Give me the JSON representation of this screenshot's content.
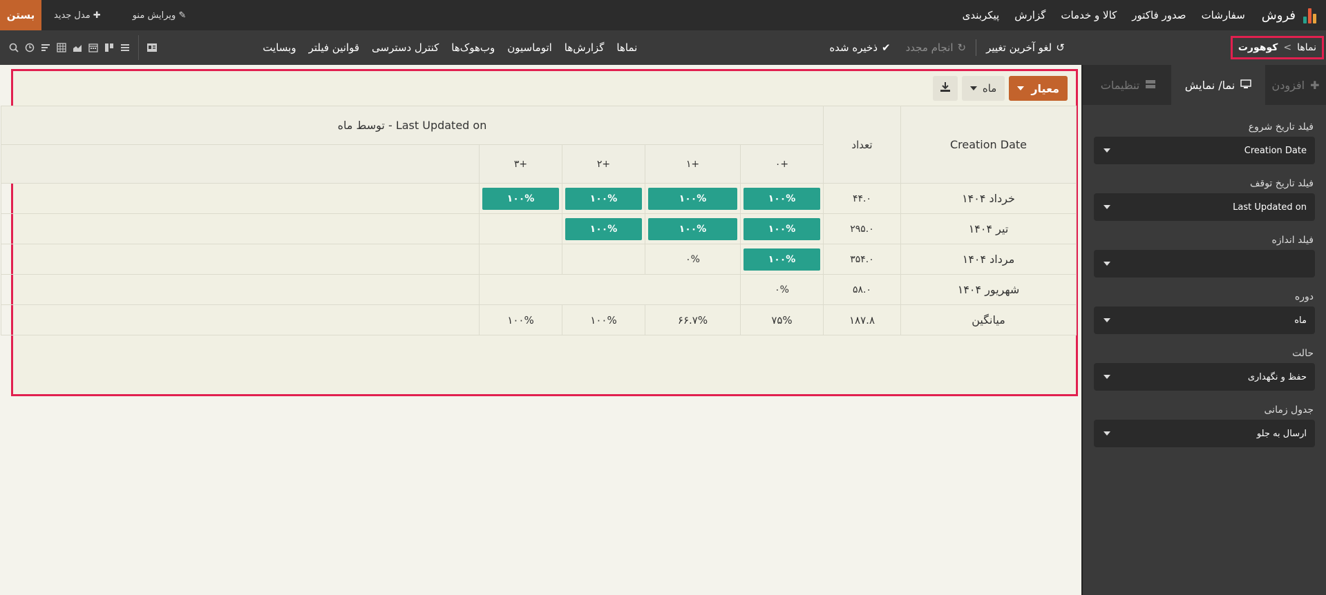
{
  "topnav": {
    "brand": "فروش",
    "brand_colors": [
      "#e9a23b",
      "#e45c3a",
      "#27a08c"
    ],
    "menu": [
      "سفارشات",
      "صدور فاکتور",
      "کالا و خدمات",
      "گزارش",
      "پیکربندی"
    ],
    "edit_menu": "ویرایش منو",
    "new_model": "مدل جدید",
    "close": "بستن"
  },
  "toolbar": {
    "breadcrumb_parent": "نماها",
    "breadcrumb_sep": ">",
    "breadcrumb_current": "کوهورت",
    "undo": "لغو آخرین تغییر",
    "redo": "انجام مجدد",
    "saved": "ذخیره شده",
    "links": [
      "نماها",
      "گزارش‌ها",
      "اتوماسیون",
      "وب‌هوک‌ها",
      "کنترل دسترسی",
      "قوانین فیلتر",
      "وبسایت"
    ],
    "view_icons": [
      "form-view-icon",
      "list-view-icon",
      "kanban-view-icon",
      "calendar-view-icon",
      "graph-view-icon",
      "pivot-view-icon",
      "cohort-view-icon",
      "activity-view-icon",
      "search-view-icon"
    ]
  },
  "sidebar": {
    "tabs": [
      {
        "label": "افزودن",
        "icon": "plus-icon"
      },
      {
        "label": "نما/ نمایش",
        "icon": "monitor-icon"
      },
      {
        "label": "تنظیمات",
        "icon": "server-icon"
      }
    ],
    "fields": [
      {
        "label": "فیلد تاریخ شروع",
        "value": "Creation Date"
      },
      {
        "label": "فیلد تاریخ توقف",
        "value": "Last Updated on"
      },
      {
        "label": "فیلد اندازه",
        "value": ""
      },
      {
        "label": "دوره",
        "value": "ماه"
      },
      {
        "label": "حالت",
        "value": "حفظ و نگهداری"
      },
      {
        "label": "جدول زمانی",
        "value": "ارسال به جلو"
      }
    ]
  },
  "main": {
    "measure_btn": "معیار",
    "interval_btn": "ماه",
    "accent": "#27a08c",
    "header": {
      "date_col": "Creation Date",
      "count_col": "تعداد",
      "group_title": "Last Updated on - توسط ماه",
      "intervals": [
        "+۰",
        "+۱",
        "+۲",
        "+۳"
      ]
    },
    "rows": [
      {
        "date": "خرداد ۱۴۰۴",
        "count": "۴۴.۰",
        "cells": [
          "۱۰۰%",
          "۱۰۰%",
          "۱۰۰%",
          "۱۰۰%"
        ],
        "filled": [
          true,
          true,
          true,
          true
        ]
      },
      {
        "date": "تیر ۱۴۰۴",
        "count": "۲۹۵.۰",
        "cells": [
          "۱۰۰%",
          "۱۰۰%",
          "۱۰۰%",
          ""
        ],
        "filled": [
          true,
          true,
          true,
          false
        ]
      },
      {
        "date": "مرداد ۱۴۰۴",
        "count": "۳۵۴.۰",
        "cells": [
          "۱۰۰%",
          "۰%",
          "",
          ""
        ],
        "filled": [
          true,
          false,
          false,
          false
        ]
      },
      {
        "date": "شهریور ۱۴۰۴",
        "count": "۵۸.۰",
        "cells": [
          "۰%",
          "",
          "",
          ""
        ],
        "filled": [
          false,
          false,
          false,
          false
        ]
      }
    ],
    "average": {
      "label": "میانگین",
      "count": "۱۸۷.۸",
      "cells": [
        "۷۵%",
        "۶۶.۷%",
        "۱۰۰%",
        "۱۰۰%"
      ]
    }
  }
}
